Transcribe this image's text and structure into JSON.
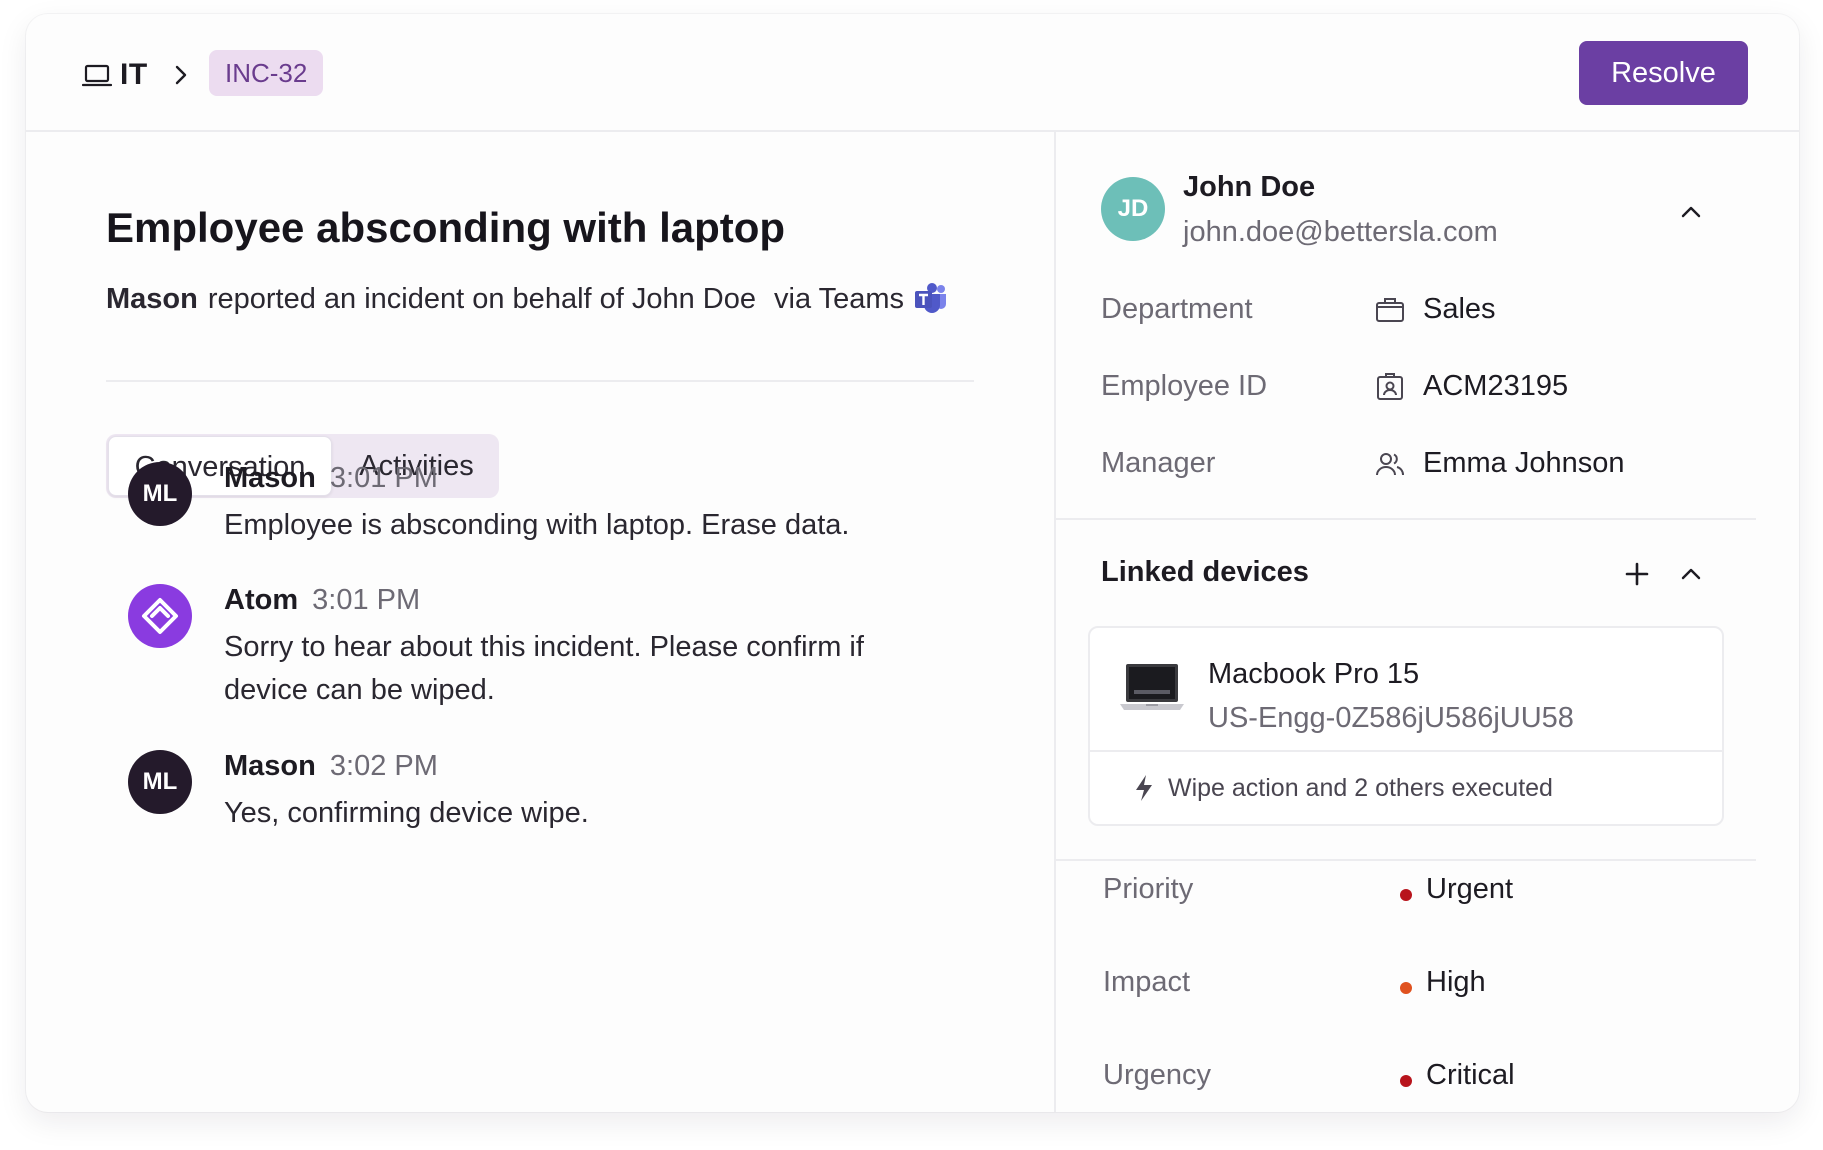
{
  "header": {
    "crumb_icon": "laptop-icon",
    "crumb_root": "IT",
    "ticket_id": "INC-32",
    "resolve_label": "Resolve"
  },
  "incident": {
    "title": "Employee absconding with laptop",
    "reporter": "Mason",
    "reported_text": "reported an incident on behalf of John Doe",
    "via_text": "via Teams"
  },
  "tabs": [
    {
      "label": "Conversation",
      "active": true
    },
    {
      "label": "Activities",
      "active": false
    }
  ],
  "messages": [
    {
      "initials": "ML",
      "author": "Mason",
      "time": "3:01 PM",
      "text": "Employee is absconding with laptop. Erase data."
    },
    {
      "initials": "",
      "author": "Atom",
      "time": "3:01 PM",
      "text": "Sorry to hear about this incident. Please confirm if device can be wiped."
    },
    {
      "initials": "ML",
      "author": "Mason",
      "time": "3:02 PM",
      "text": "Yes, confirming device wipe."
    }
  ],
  "contact": {
    "initials": "JD",
    "name": "John Doe",
    "email": "john.doe@bettersla.com",
    "fields": [
      {
        "label": "Department",
        "icon": "briefcase-icon",
        "value": "Sales"
      },
      {
        "label": "Employee ID",
        "icon": "id-badge-icon",
        "value": "ACM23195"
      },
      {
        "label": "Manager",
        "icon": "people-icon",
        "value": "Emma Johnson"
      }
    ]
  },
  "linked_devices": {
    "title": "Linked devices",
    "device": {
      "name": "Macbook Pro 15",
      "id": "US-Engg-0Z586jU586jUU58",
      "status": "Wipe action and 2 others executed"
    }
  },
  "attributes": [
    {
      "label": "Priority",
      "value": "Urgent",
      "color": "#b8141c"
    },
    {
      "label": "Impact",
      "value": "High",
      "color": "#e0521f"
    },
    {
      "label": "Urgency",
      "value": "Critical",
      "color": "#b8141c"
    }
  ],
  "colors": {
    "accent": "#6b3fa3",
    "badge_bg": "#ecdcf0",
    "contact_avatar": "#6dbfb8",
    "atom_avatar": "#8a3be0"
  }
}
